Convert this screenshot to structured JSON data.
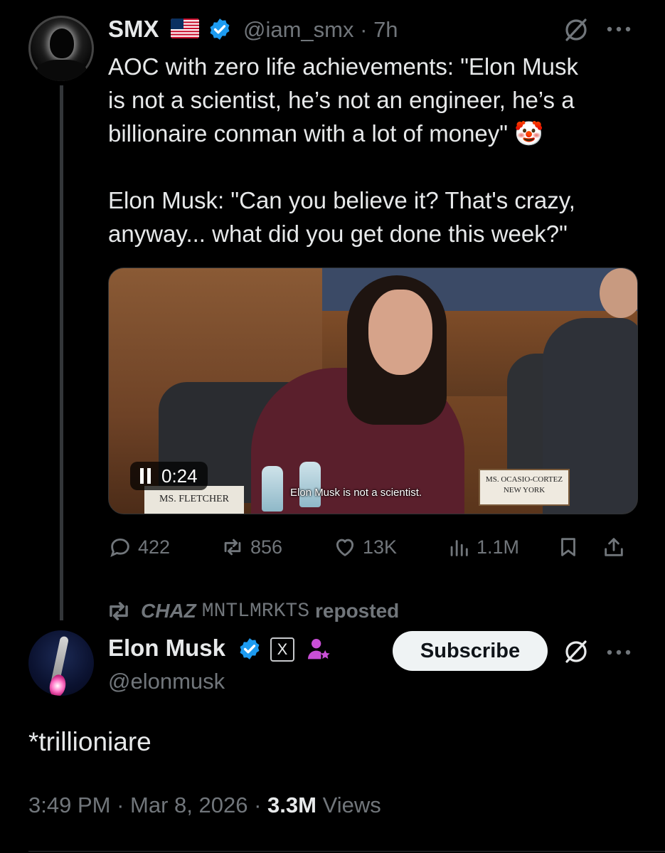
{
  "parent_tweet": {
    "display_name": "SMX",
    "flag": "🇺🇸",
    "handle": "@iam_smx",
    "separator": "·",
    "time": "7h",
    "text": "AOC with zero life achievements: \"Elon Musk\nis not a scientist, he’s not an engineer, he’s a\nbillionaire conman with a lot of money\" 🤡\n\nElon Musk: \"Can you believe it? That's crazy,\nanyway... what did you get done this week?\"",
    "video": {
      "timestamp": "0:24",
      "caption": "Elon Musk is not a scientist.",
      "nameplate_left": "MS. FLETCHER",
      "nameplate_right_line1": "MS. OCASIO-CORTEZ",
      "nameplate_right_line2": "NEW YORK"
    },
    "stats": {
      "replies": "422",
      "reposts": "856",
      "likes": "13K",
      "views": "1.1M"
    }
  },
  "repost_banner": {
    "user_part1": "CHAZ",
    "user_part2": "MNTLMRKTS",
    "action": "reposted"
  },
  "reply_tweet": {
    "display_name": "Elon Musk",
    "handle": "@elonmusk",
    "x_badge": "X",
    "subscribe_label": "Subscribe",
    "text": "*trillioniare",
    "time": "3:49 PM",
    "date": "Mar 8, 2026",
    "views_count": "3.3M",
    "views_label": "Views",
    "dot": "·"
  },
  "colors": {
    "background": "#000000",
    "text_primary": "#e7e9ea",
    "text_secondary": "#71767b",
    "verified_blue": "#1d9bf0",
    "affiliate_purple": "#c94fd6"
  },
  "icons": [
    "grok-icon",
    "more-icon",
    "reply-icon",
    "repost-icon",
    "like-icon",
    "views-icon",
    "bookmark-icon",
    "share-icon",
    "verified-icon",
    "pause-icon",
    "affiliate-icon"
  ]
}
